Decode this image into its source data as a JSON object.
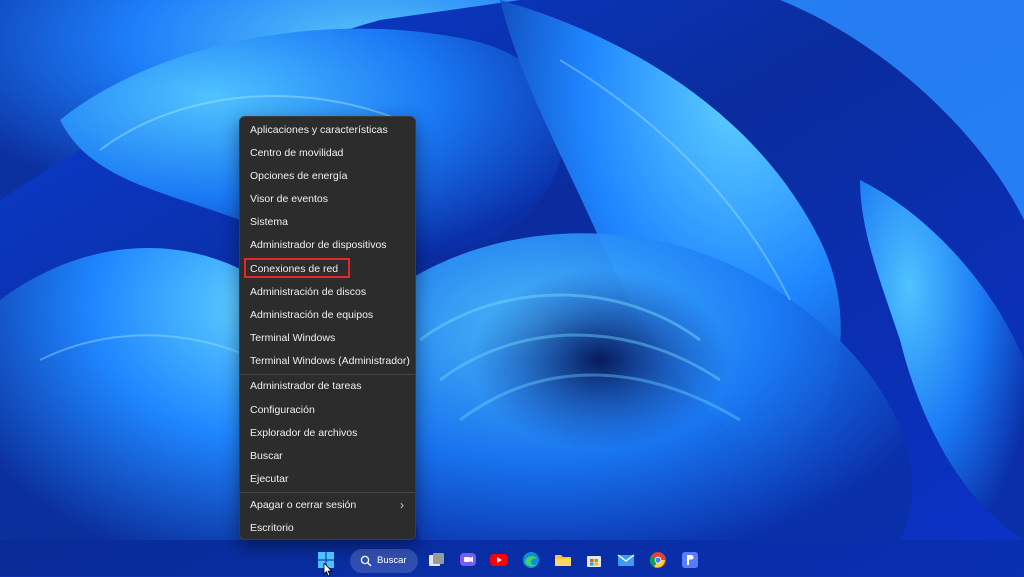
{
  "menu": {
    "groups": [
      [
        "Aplicaciones y características",
        "Centro de movilidad",
        "Opciones de energía",
        "Visor de eventos",
        "Sistema",
        "Administrador de dispositivos",
        "Conexiones de red",
        "Administración de discos",
        "Administración de equipos",
        "Terminal Windows",
        "Terminal Windows (Administrador)"
      ],
      [
        "Administrador de tareas",
        "Configuración",
        "Explorador de archivos",
        "Buscar",
        "Ejecutar"
      ],
      [
        "Apagar o cerrar sesión",
        "Escritorio"
      ]
    ],
    "highlighted_item": "Conexiones de red",
    "highlight_color": "#e32626",
    "submenu_item": "Apagar o cerrar sesión"
  },
  "taskbar": {
    "search_label": "Buscar",
    "icons": [
      "start-icon",
      "search-icon",
      "task-view-icon",
      "chat-icon",
      "youtube-icon",
      "edge-icon",
      "file-explorer-icon",
      "store-icon",
      "mail-icon",
      "chrome-icon",
      "p-app-icon"
    ]
  },
  "colors": {
    "wallpaper_dark": "#0a2fb0",
    "wallpaper_light": "#36a6ff",
    "menu_bg": "#2c2c2c"
  }
}
